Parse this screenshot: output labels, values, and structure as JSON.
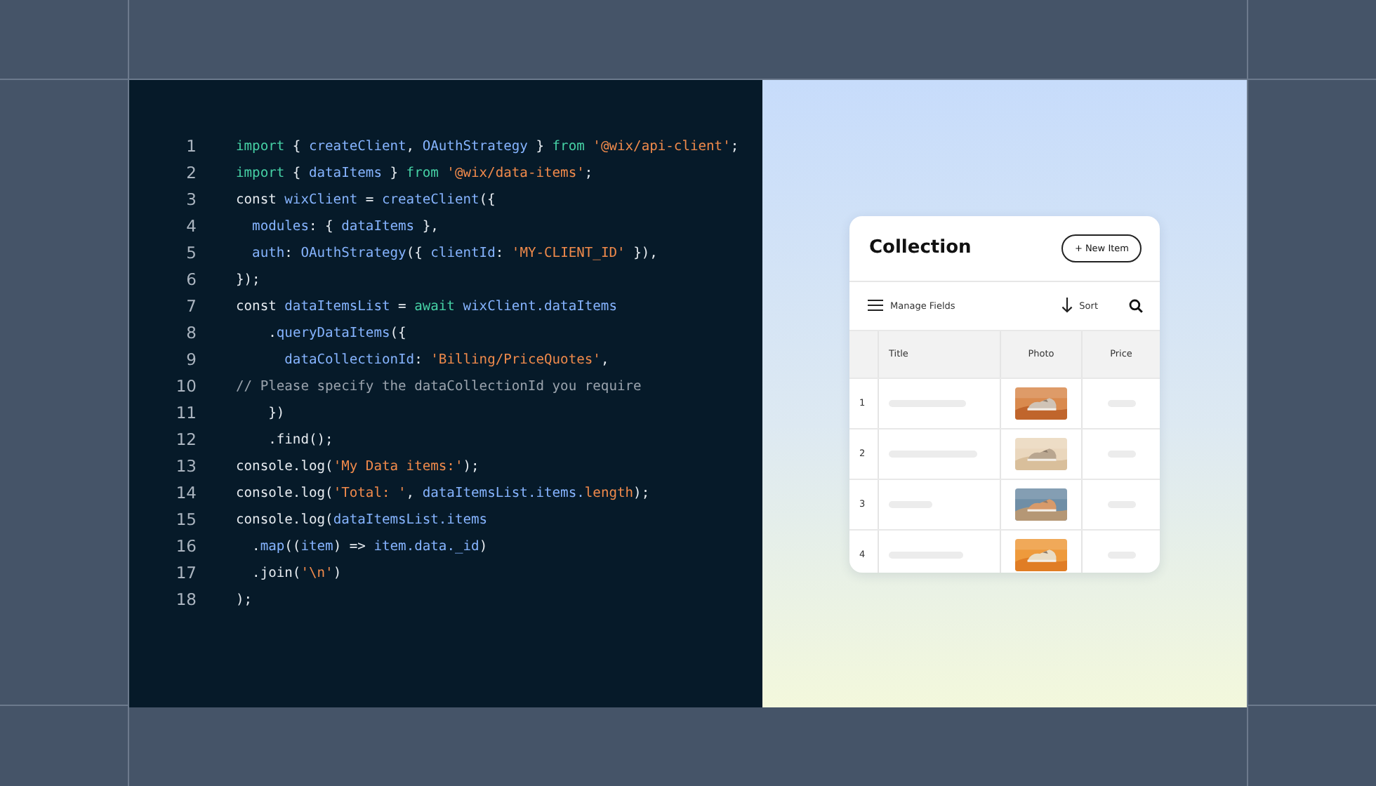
{
  "code": {
    "lines": [
      {
        "number": "1",
        "tokens": [
          {
            "kind": "keyword",
            "text": "import"
          },
          {
            "kind": "plain",
            "text": " { "
          },
          {
            "kind": "ident",
            "text": "createClient"
          },
          {
            "kind": "plain",
            "text": ", "
          },
          {
            "kind": "ident",
            "text": "OAuthStrategy"
          },
          {
            "kind": "plain",
            "text": " } "
          },
          {
            "kind": "keyword",
            "text": "from"
          },
          {
            "kind": "string",
            "text": " '@wix/api-client'"
          },
          {
            "kind": "plain",
            "text": ";"
          }
        ]
      },
      {
        "number": "2",
        "tokens": [
          {
            "kind": "keyword",
            "text": "import"
          },
          {
            "kind": "plain",
            "text": " { "
          },
          {
            "kind": "ident",
            "text": "dataItems"
          },
          {
            "kind": "plain",
            "text": " } "
          },
          {
            "kind": "keyword",
            "text": "from"
          },
          {
            "kind": "string",
            "text": " '@wix/data-items'"
          },
          {
            "kind": "plain",
            "text": ";"
          }
        ]
      },
      {
        "number": "3",
        "tokens": [
          {
            "kind": "plain",
            "text": "const "
          },
          {
            "kind": "ident",
            "text": "wixClient"
          },
          {
            "kind": "plain",
            "text": " = "
          },
          {
            "kind": "ident",
            "text": "createClient"
          },
          {
            "kind": "plain",
            "text": "({"
          }
        ]
      },
      {
        "number": "4",
        "tokens": [
          {
            "kind": "ident",
            "text": "  modules"
          },
          {
            "kind": "plain",
            "text": ": { "
          },
          {
            "kind": "ident",
            "text": "dataItems"
          },
          {
            "kind": "plain",
            "text": " },"
          }
        ]
      },
      {
        "number": "5",
        "tokens": [
          {
            "kind": "ident",
            "text": "  auth"
          },
          {
            "kind": "plain",
            "text": ": "
          },
          {
            "kind": "ident",
            "text": "OAuthStrategy"
          },
          {
            "kind": "plain",
            "text": "({ "
          },
          {
            "kind": "ident",
            "text": "clientId"
          },
          {
            "kind": "plain",
            "text": ": "
          },
          {
            "kind": "string",
            "text": "'MY-CLIENT_ID'"
          },
          {
            "kind": "plain",
            "text": " }),"
          }
        ]
      },
      {
        "number": "6",
        "tokens": [
          {
            "kind": "plain",
            "text": "});"
          }
        ]
      },
      {
        "number": "7",
        "tokens": [
          {
            "kind": "plain",
            "text": "const "
          },
          {
            "kind": "ident",
            "text": "dataItemsList"
          },
          {
            "kind": "plain",
            "text": " = "
          },
          {
            "kind": "keyword",
            "text": "await"
          },
          {
            "kind": "ident",
            "text": " wixClient.dataItems"
          }
        ]
      },
      {
        "number": "8",
        "tokens": [
          {
            "kind": "plain",
            "text": "    ."
          },
          {
            "kind": "ident",
            "text": "queryDataItems"
          },
          {
            "kind": "plain",
            "text": "({"
          }
        ]
      },
      {
        "number": "9",
        "tokens": [
          {
            "kind": "ident",
            "text": "      dataCollectionId"
          },
          {
            "kind": "plain",
            "text": ": "
          },
          {
            "kind": "string",
            "text": "'Billing/PriceQuotes'"
          },
          {
            "kind": "plain",
            "text": ","
          }
        ]
      },
      {
        "number": "10",
        "tokens": [
          {
            "kind": "comment",
            "text": "// Please specify the dataCollectionId you require"
          }
        ]
      },
      {
        "number": "11",
        "tokens": [
          {
            "kind": "plain",
            "text": "    })"
          }
        ]
      },
      {
        "number": "12",
        "tokens": [
          {
            "kind": "plain",
            "text": "    .find();"
          }
        ]
      },
      {
        "number": "13",
        "tokens": [
          {
            "kind": "plain",
            "text": "console.log("
          },
          {
            "kind": "string",
            "text": "'My Data items:'"
          },
          {
            "kind": "plain",
            "text": ");"
          }
        ]
      },
      {
        "number": "14",
        "tokens": [
          {
            "kind": "plain",
            "text": "console.log("
          },
          {
            "kind": "string",
            "text": "'Total: '"
          },
          {
            "kind": "plain",
            "text": ", "
          },
          {
            "kind": "ident",
            "text": "dataItemsList.items."
          },
          {
            "kind": "string",
            "text": "length"
          },
          {
            "kind": "plain",
            "text": ");"
          }
        ]
      },
      {
        "number": "15",
        "tokens": [
          {
            "kind": "plain",
            "text": "console.log("
          },
          {
            "kind": "ident",
            "text": "dataItemsList.items"
          }
        ]
      },
      {
        "number": "16",
        "tokens": [
          {
            "kind": "plain",
            "text": "  ."
          },
          {
            "kind": "ident",
            "text": "map"
          },
          {
            "kind": "plain",
            "text": "(("
          },
          {
            "kind": "ident",
            "text": "item"
          },
          {
            "kind": "plain",
            "text": ") => "
          },
          {
            "kind": "ident",
            "text": "item.data._id"
          },
          {
            "kind": "plain",
            "text": ")"
          }
        ]
      },
      {
        "number": "17",
        "tokens": [
          {
            "kind": "plain",
            "text": "  .join("
          },
          {
            "kind": "string",
            "text": "'\\n'"
          },
          {
            "kind": "plain",
            "text": ")"
          }
        ]
      },
      {
        "number": "18",
        "tokens": [
          {
            "kind": "plain",
            "text": ");"
          }
        ]
      }
    ]
  },
  "collection": {
    "title": "Collection",
    "new_button": "+ New Item",
    "toolbar": {
      "manage_fields": "Manage Fields",
      "sort": "Sort"
    },
    "table": {
      "columns": [
        "Title",
        "Photo",
        "Price"
      ],
      "rows": [
        {
          "index": "1"
        },
        {
          "index": "2"
        },
        {
          "index": "3"
        },
        {
          "index": "4"
        }
      ]
    }
  }
}
